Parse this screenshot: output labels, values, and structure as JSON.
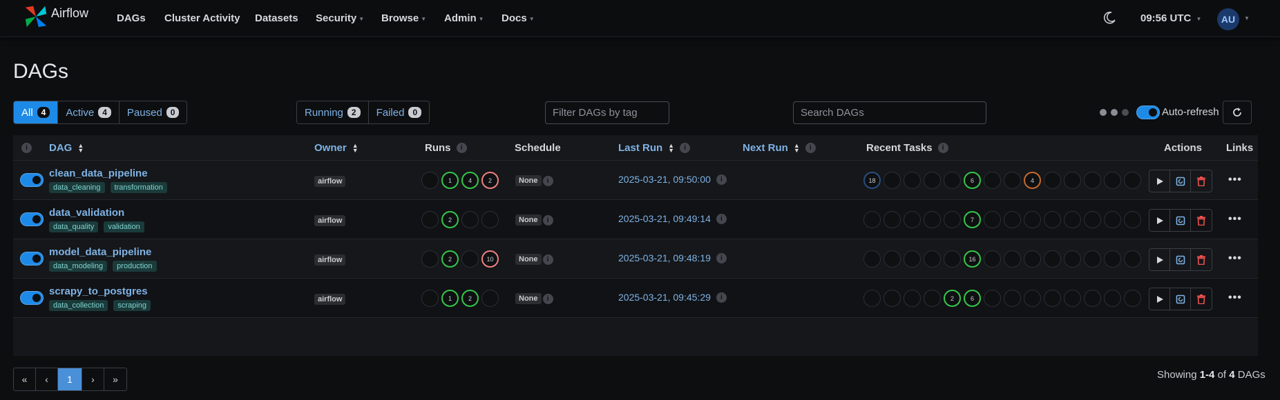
{
  "nav": {
    "brand": "Airflow",
    "items": [
      {
        "label": "DAGs",
        "caret": false
      },
      {
        "label": "Cluster Activity",
        "caret": false
      },
      {
        "label": "Datasets",
        "caret": false
      },
      {
        "label": "Security",
        "caret": true
      },
      {
        "label": "Browse",
        "caret": true
      },
      {
        "label": "Admin",
        "caret": true
      },
      {
        "label": "Docs",
        "caret": true
      }
    ],
    "time": "09:56 UTC",
    "user_initials": "AU",
    "theme_icon": "moon-icon"
  },
  "page": {
    "title": "DAGs"
  },
  "filters": {
    "status_tabs": [
      {
        "label": "All",
        "count": "4",
        "active": true
      },
      {
        "label": "Active",
        "count": "4",
        "active": false
      },
      {
        "label": "Paused",
        "count": "0",
        "active": false
      }
    ],
    "run_tabs": [
      {
        "label": "Running",
        "count": "2"
      },
      {
        "label": "Failed",
        "count": "0"
      }
    ],
    "tag_placeholder": "Filter DAGs by tag",
    "search_placeholder": "Search DAGs",
    "auto_refresh_label": "Auto-refresh",
    "auto_refresh_on": true
  },
  "table": {
    "headers": {
      "dag": "DAG",
      "owner": "Owner",
      "runs": "Runs",
      "schedule": "Schedule",
      "last_run": "Last Run",
      "next_run": "Next Run",
      "recent_tasks": "Recent Tasks",
      "actions": "Actions",
      "links": "Links"
    },
    "rows": [
      {
        "name": "clean_data_pipeline",
        "tags": [
          "data_cleaning",
          "transformation"
        ],
        "owner": "airflow",
        "runs": [
          {
            "n": "",
            "s": "none"
          },
          {
            "n": "1",
            "s": "success"
          },
          {
            "n": "4",
            "s": "success"
          },
          {
            "n": "2",
            "s": "failed"
          }
        ],
        "schedule": "None",
        "last_run": "2025-03-21, 09:50:00",
        "tasks": [
          {
            "n": "18",
            "s": "queued"
          },
          {
            "n": "",
            "s": "none"
          },
          {
            "n": "",
            "s": "none"
          },
          {
            "n": "",
            "s": "none"
          },
          {
            "n": "",
            "s": "none"
          },
          {
            "n": "6",
            "s": "success"
          },
          {
            "n": "",
            "s": "none"
          },
          {
            "n": "",
            "s": "none"
          },
          {
            "n": "4",
            "s": "upstream"
          },
          {
            "n": "",
            "s": "none"
          },
          {
            "n": "",
            "s": "none"
          },
          {
            "n": "",
            "s": "none"
          },
          {
            "n": "",
            "s": "none"
          },
          {
            "n": "",
            "s": "none"
          }
        ]
      },
      {
        "name": "data_validation",
        "tags": [
          "data_quality",
          "validation"
        ],
        "owner": "airflow",
        "runs": [
          {
            "n": "",
            "s": "none"
          },
          {
            "n": "2",
            "s": "success"
          },
          {
            "n": "",
            "s": "none"
          },
          {
            "n": "",
            "s": "none"
          }
        ],
        "schedule": "None",
        "last_run": "2025-03-21, 09:49:14",
        "tasks": [
          {
            "n": "",
            "s": "none"
          },
          {
            "n": "",
            "s": "none"
          },
          {
            "n": "",
            "s": "none"
          },
          {
            "n": "",
            "s": "none"
          },
          {
            "n": "",
            "s": "none"
          },
          {
            "n": "7",
            "s": "success"
          },
          {
            "n": "",
            "s": "none"
          },
          {
            "n": "",
            "s": "none"
          },
          {
            "n": "",
            "s": "none"
          },
          {
            "n": "",
            "s": "none"
          },
          {
            "n": "",
            "s": "none"
          },
          {
            "n": "",
            "s": "none"
          },
          {
            "n": "",
            "s": "none"
          },
          {
            "n": "",
            "s": "none"
          }
        ]
      },
      {
        "name": "model_data_pipeline",
        "tags": [
          "data_modeling",
          "production"
        ],
        "owner": "airflow",
        "runs": [
          {
            "n": "",
            "s": "none"
          },
          {
            "n": "2",
            "s": "success"
          },
          {
            "n": "",
            "s": "none"
          },
          {
            "n": "10",
            "s": "failed"
          }
        ],
        "schedule": "None",
        "last_run": "2025-03-21, 09:48:19",
        "tasks": [
          {
            "n": "",
            "s": "none"
          },
          {
            "n": "",
            "s": "none"
          },
          {
            "n": "",
            "s": "none"
          },
          {
            "n": "",
            "s": "none"
          },
          {
            "n": "",
            "s": "none"
          },
          {
            "n": "16",
            "s": "success"
          },
          {
            "n": "",
            "s": "none"
          },
          {
            "n": "",
            "s": "none"
          },
          {
            "n": "",
            "s": "none"
          },
          {
            "n": "",
            "s": "none"
          },
          {
            "n": "",
            "s": "none"
          },
          {
            "n": "",
            "s": "none"
          },
          {
            "n": "",
            "s": "none"
          },
          {
            "n": "",
            "s": "none"
          }
        ]
      },
      {
        "name": "scrapy_to_postgres",
        "tags": [
          "data_collection",
          "scraping"
        ],
        "owner": "airflow",
        "runs": [
          {
            "n": "",
            "s": "none"
          },
          {
            "n": "1",
            "s": "success"
          },
          {
            "n": "2",
            "s": "success"
          },
          {
            "n": "",
            "s": "none"
          }
        ],
        "schedule": "None",
        "last_run": "2025-03-21, 09:45:29",
        "tasks": [
          {
            "n": "",
            "s": "none"
          },
          {
            "n": "",
            "s": "none"
          },
          {
            "n": "",
            "s": "none"
          },
          {
            "n": "",
            "s": "none"
          },
          {
            "n": "2",
            "s": "success"
          },
          {
            "n": "6",
            "s": "success"
          },
          {
            "n": "",
            "s": "none"
          },
          {
            "n": "",
            "s": "none"
          },
          {
            "n": "",
            "s": "none"
          },
          {
            "n": "",
            "s": "none"
          },
          {
            "n": "",
            "s": "none"
          },
          {
            "n": "",
            "s": "none"
          },
          {
            "n": "",
            "s": "none"
          },
          {
            "n": "",
            "s": "none"
          }
        ]
      }
    ]
  },
  "pagination": {
    "first": "«",
    "prev": "‹",
    "current": "1",
    "next": "›",
    "last": "»",
    "showing_prefix": "Showing",
    "range": "1-4",
    "of": "of",
    "total": "4",
    "suffix": "DAGs"
  },
  "colors": {
    "accent": "#1e8ae8",
    "link": "#7fb3e6",
    "success": "#35c74a",
    "failed": "#f08080",
    "queued": "#2a4f7f",
    "upstream": "#c56a2c"
  }
}
